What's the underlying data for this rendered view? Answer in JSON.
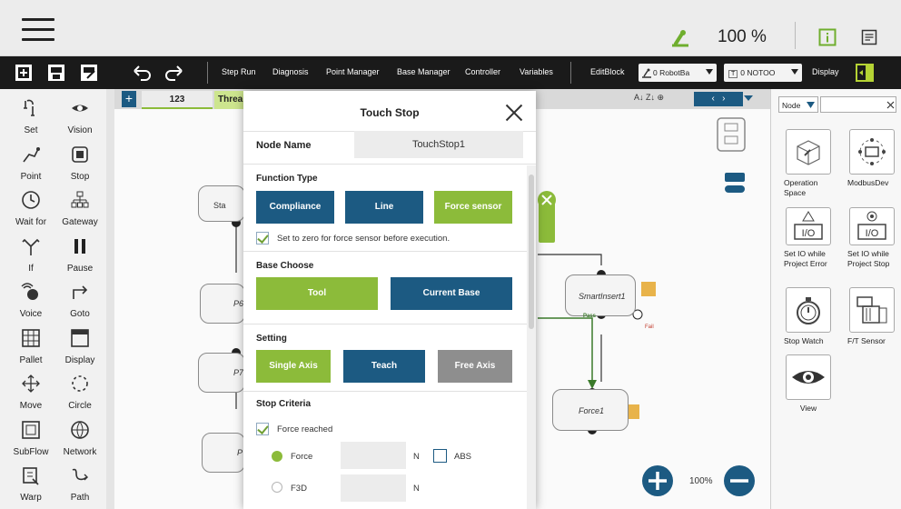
{
  "topbar": {
    "zoom": "100 %"
  },
  "toolbar": {
    "items": [
      {
        "label": "Step Run"
      },
      {
        "label": "Diagnosis"
      },
      {
        "label": "Point Manager"
      },
      {
        "label": "Base Manager"
      },
      {
        "label": "Controller"
      },
      {
        "label": "Variables"
      },
      {
        "label": "EditBlock"
      }
    ],
    "robot_base": "0 RobotBa",
    "tool": "0 NOTOO",
    "tool_prefix": "T",
    "display": "Display"
  },
  "sidebar": {
    "items": [
      {
        "label": "Set",
        "icon": "set-icon"
      },
      {
        "label": "Vision",
        "icon": "vision-icon"
      },
      {
        "label": "Point",
        "icon": "point-icon"
      },
      {
        "label": "Stop",
        "icon": "stop-icon"
      },
      {
        "label": "Wait for",
        "icon": "wait-icon"
      },
      {
        "label": "Gateway",
        "icon": "gateway-icon"
      },
      {
        "label": "If",
        "icon": "if-icon"
      },
      {
        "label": "Pause",
        "icon": "pause-icon"
      },
      {
        "label": "Voice",
        "icon": "voice-icon"
      },
      {
        "label": "Goto",
        "icon": "goto-icon"
      },
      {
        "label": "Pallet",
        "icon": "pallet-icon"
      },
      {
        "label": "Display",
        "icon": "display-icon"
      },
      {
        "label": "Move",
        "icon": "move-icon"
      },
      {
        "label": "Circle",
        "icon": "circle-icon"
      },
      {
        "label": "SubFlow",
        "icon": "subflow-icon"
      },
      {
        "label": "Network",
        "icon": "network-icon"
      },
      {
        "label": "Warp",
        "icon": "warp-icon"
      },
      {
        "label": "Path",
        "icon": "path-icon"
      }
    ]
  },
  "canvas": {
    "tabs": [
      {
        "label": "123"
      },
      {
        "label": "Threa"
      }
    ],
    "nodes": {
      "start": "Sta",
      "p6": "P6",
      "p7": "P7",
      "p": "P",
      "smartinsert": "SmartInsert1",
      "force": "Force1",
      "pass": "Pass",
      "fail": "Fail"
    },
    "zoom": "100%",
    "toggle": "OFF"
  },
  "right_panel": {
    "filter": "Node",
    "search_placeholder": "",
    "items": [
      {
        "label": "Operation Space",
        "icon": "operation-space-icon"
      },
      {
        "label": "ModbusDev",
        "icon": "modbus-icon"
      },
      {
        "label": "Set IO while Project Error",
        "icon": "io-icon",
        "io_text": "I/O"
      },
      {
        "label": "Set IO while Project Stop",
        "icon": "io-icon",
        "io_text": "I/O"
      },
      {
        "label": "Stop Watch",
        "icon": "stopwatch-icon"
      },
      {
        "label": "F/T Sensor",
        "icon": "ft-sensor-icon"
      },
      {
        "label": "View",
        "icon": "eye-icon"
      }
    ]
  },
  "modal": {
    "title": "Touch Stop",
    "node_name_label": "Node Name",
    "node_name_value": "TouchStop1",
    "function_type": {
      "heading": "Function Type",
      "options": [
        "Compliance",
        "Line",
        "Force sensor"
      ],
      "selected": "Force sensor",
      "zero_label": "Set to zero for force sensor before execution.",
      "zero_checked": true
    },
    "base_choose": {
      "heading": "Base Choose",
      "options": [
        "Tool",
        "Current Base"
      ],
      "selected": "Tool"
    },
    "setting": {
      "heading": "Setting",
      "options": [
        "Single Axis",
        "Teach",
        "Free Axis"
      ],
      "selected": "Single Axis"
    },
    "stop_criteria": {
      "heading": "Stop Criteria",
      "force_reached_label": "Force reached",
      "force_reached_checked": true,
      "force_label": "Force",
      "force_value": "",
      "force_unit": "N",
      "abs_label": "ABS",
      "f3d_label": "F3D",
      "f3d_value": "",
      "f3d_unit": "N"
    }
  },
  "colors": {
    "accent_green": "#8cbb3a",
    "accent_blue": "#1c5a82",
    "disabled_gray": "#8e8e8e",
    "toolbar_bg": "#1a1a1a"
  }
}
